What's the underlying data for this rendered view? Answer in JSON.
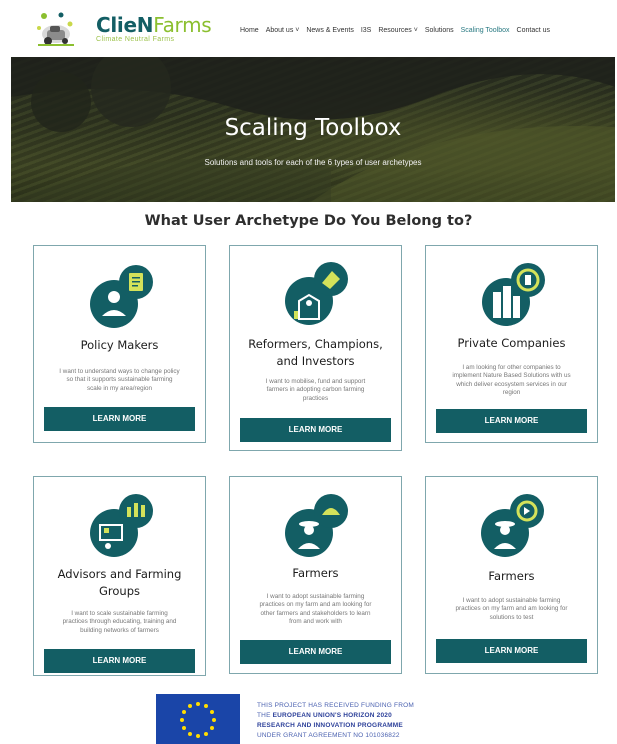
{
  "brand": {
    "name_strong": "ClieN",
    "name_light": "Farms",
    "tagline": "Climate Neutral Farms"
  },
  "nav": [
    {
      "label": "Home"
    },
    {
      "label": "About us ˅"
    },
    {
      "label": "News & Events"
    },
    {
      "label": "I3S"
    },
    {
      "label": "Resources ˅"
    },
    {
      "label": "Solutions"
    },
    {
      "label": "Scaling Toolbox"
    },
    {
      "label": "Contact us"
    }
  ],
  "hero": {
    "title": "Scaling Toolbox",
    "subtitle": "Solutions and tools for each of the 6 types of user archetypes"
  },
  "section_title": "What User Archetype Do You Belong to?",
  "cards": [
    {
      "title_lines": [
        "Policy Makers"
      ],
      "desc_lines": [
        "I want to understand ways to change policy",
        "so that it supports sustainable farming",
        "scale in my area/region"
      ],
      "button": "LEARN MORE"
    },
    {
      "title_lines": [
        "Reformers, Champions,",
        "and Investors"
      ],
      "desc_lines": [
        "I want to mobilise, fund and support",
        "farmers in adopting carbon farming",
        "practices"
      ],
      "button": "LEARN MORE"
    },
    {
      "title_lines": [
        "Private Companies"
      ],
      "desc_lines": [
        "I am looking for other companies to",
        "implement Nature Based Solutions with us",
        "which deliver ecosystem services in our",
        "region"
      ],
      "button": "LEARN MORE"
    },
    {
      "title_lines": [
        "Advisors and Farming",
        "Groups"
      ],
      "desc_lines": [
        "I want to scale sustainable farming",
        "practices through educating, training and",
        "building networks of farmers"
      ],
      "button": "LEARN MORE"
    },
    {
      "title_lines": [
        "Farmers"
      ],
      "desc_lines": [
        "I want to adopt sustainable farming",
        "practices on my farm and am looking for",
        "other farmers and stakeholders to learn",
        "from and work with"
      ],
      "button": "LEARN MORE"
    },
    {
      "title_lines": [
        "Farmers"
      ],
      "desc_lines": [
        "I want to adopt sustainable farming",
        "practices on my farm and am looking for",
        "solutions to test"
      ],
      "button": "LEARN MORE"
    }
  ],
  "funding": {
    "line1": "THIS PROJECT HAS RECEIVED FUNDING FROM",
    "line2_prefix": "THE ",
    "line2_bold": "EUROPEAN UNION'S HORIZON 2020",
    "line3": "RESEARCH AND INNOVATION PROGRAMME",
    "line4": "UNDER GRANT AGREEMENT NO 101036822"
  },
  "colors": {
    "teal": "#135e64",
    "lime": "#8bbf2f",
    "card_border": "#7fa7ad",
    "eu_blue": "#1a45a8",
    "eu_star": "#ffdd00"
  }
}
